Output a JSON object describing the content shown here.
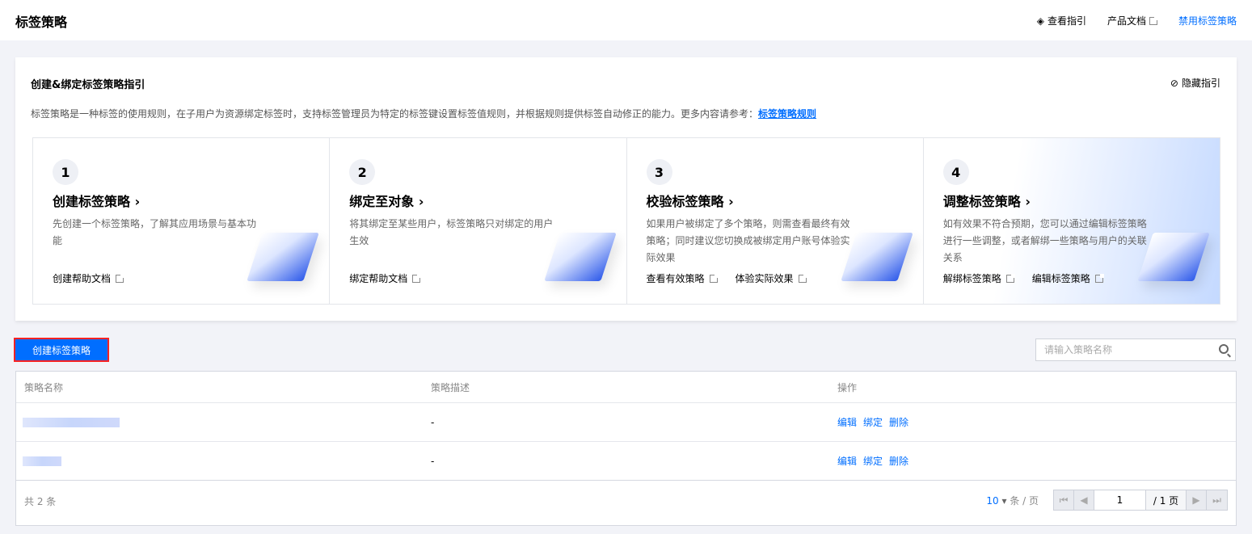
{
  "header": {
    "title": "标签策略",
    "view_guide": "查看指引",
    "product_docs": "产品文档",
    "disable_policy": "禁用标签策略"
  },
  "guide": {
    "title": "创建&绑定标签策略指引",
    "hide": "隐藏指引",
    "desc": "标签策略是一种标签的使用规则，在子用户为资源绑定标签时，支持标签管理员为特定的标签键设置标签值规则，并根据规则提供标签自动修正的能力。更多内容请参考：",
    "desc_link": "标签策略规则",
    "cards": [
      {
        "num": "1",
        "title": "创建标签策略 ›",
        "text": "先创建一个标签策略，了解其应用场景与基本功能",
        "links": [
          "创建帮助文档"
        ]
      },
      {
        "num": "2",
        "title": "绑定至对象 ›",
        "text": "将其绑定至某些用户，标签策略只对绑定的用户生效",
        "links": [
          "绑定帮助文档"
        ]
      },
      {
        "num": "3",
        "title": "校验标签策略 ›",
        "text": "如果用户被绑定了多个策略，则需查看最终有效策略；同时建议您切换成被绑定用户账号体验实际效果",
        "links": [
          "查看有效策略",
          "体验实际效果"
        ]
      },
      {
        "num": "4",
        "title": "调整标签策略 ›",
        "text": "如有效果不符合预期，您可以通过编辑标签策略进行一些调整，或者解绑一些策略与用户的关联关系",
        "links": [
          "解绑标签策略",
          "编辑标签策略"
        ]
      }
    ]
  },
  "toolbar": {
    "create": "创建标签策略",
    "search_placeholder": "请输入策略名称"
  },
  "table": {
    "headers": [
      "策略名称",
      "策略描述",
      "操作"
    ],
    "rows": [
      {
        "desc": "-",
        "ops": [
          "编辑",
          "绑定",
          "删除"
        ]
      },
      {
        "desc": "-",
        "ops": [
          "编辑",
          "绑定",
          "删除"
        ]
      }
    ],
    "total": "共 2 条",
    "page_size": "10",
    "per_page": "条 / 页",
    "page": "1",
    "total_pages": "/ 1 页"
  }
}
